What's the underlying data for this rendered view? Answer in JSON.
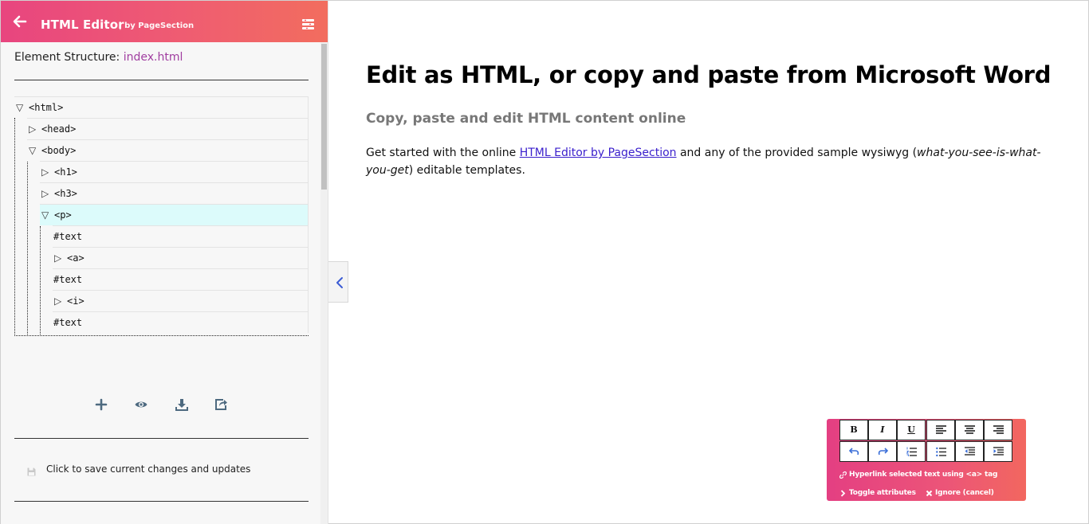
{
  "sidebar": {
    "header": {
      "title": "HTML Editor",
      "subtitle": "| by PageSection"
    },
    "structure_label": "Element Structure:",
    "structure_file": "index.html",
    "tree": [
      {
        "label": "<html>",
        "toggle": "▽"
      },
      {
        "label": "<head>",
        "toggle": "▷"
      },
      {
        "label": "<body>",
        "toggle": "▽"
      },
      {
        "label": "<h1>",
        "toggle": "▷"
      },
      {
        "label": "<h3>",
        "toggle": "▷"
      },
      {
        "label": "<p>",
        "toggle": "▽"
      },
      {
        "label": "#text",
        "toggle": ""
      },
      {
        "label": "<a>",
        "toggle": "▷"
      },
      {
        "label": "#text",
        "toggle": ""
      },
      {
        "label": "<i>",
        "toggle": "▷"
      },
      {
        "label": "#text",
        "toggle": ""
      }
    ],
    "actions": [
      "plus-icon",
      "eye-icon",
      "download-icon",
      "share-icon"
    ],
    "save_text": "Click to save current changes and updates"
  },
  "content": {
    "h1": "Edit as HTML, or copy and paste from Microsoft Word",
    "h3": "Copy, paste and edit HTML content online",
    "para_1": "Get started with the online ",
    "para_link": "HTML Editor by PageSection",
    "para_2": " and any of the provided sample wysiwyg (",
    "para_italic": "what-you-see-is-what-you-get",
    "para_3": ") editable templates."
  },
  "toolbar": {
    "bold": "B",
    "italic": "I",
    "underline": "U",
    "hyperlink_text": "Hyperlink selected text using <a> tag",
    "toggle_text": "Toggle attributes",
    "ignore_text": "Ignore (cancel)"
  },
  "colors": {
    "header_gradient_start": "#e8457f",
    "header_gradient_end": "#f26d5e",
    "selected_row": "#dcfbfb",
    "file_link": "#a03ea0",
    "content_link": "#3a1fcc"
  }
}
